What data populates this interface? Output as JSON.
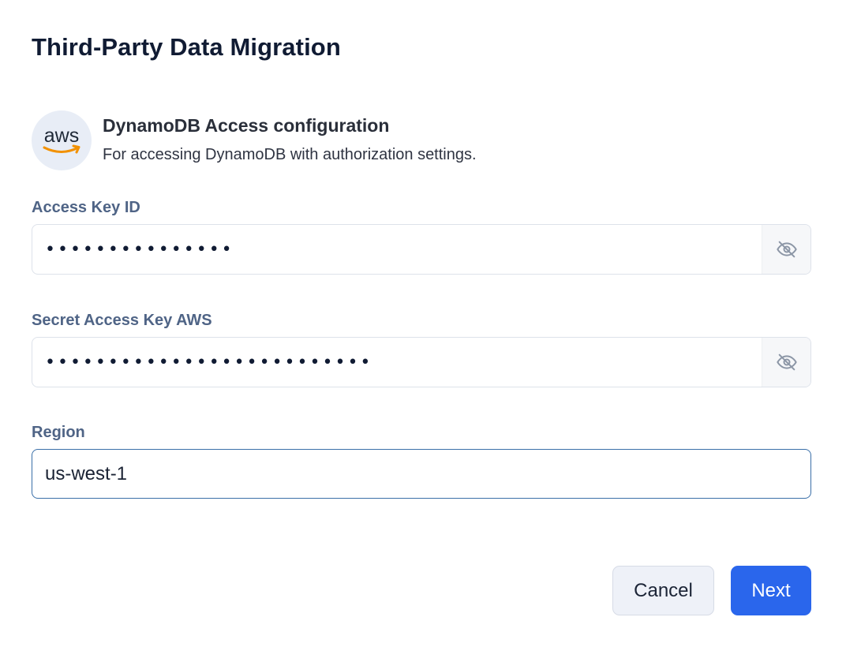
{
  "dialog": {
    "title": "Third-Party Data Migration"
  },
  "provider": {
    "logo_text": "aws",
    "title": "DynamoDB Access configuration",
    "description": "For accessing DynamoDB with authorization settings."
  },
  "fields": {
    "access_key": {
      "label": "Access Key ID",
      "masked_value": "•••••••••••••••",
      "toggle_icon": "eye-off-icon"
    },
    "secret_key": {
      "label": "Secret Access Key AWS",
      "masked_value": "••••••••••••••••••••••••••",
      "toggle_icon": "eye-off-icon"
    },
    "region": {
      "label": "Region",
      "value": "us-west-1"
    }
  },
  "buttons": {
    "cancel": "Cancel",
    "next": "Next"
  },
  "colors": {
    "title": "#101b33",
    "label": "#4f6486",
    "primary": "#2a66ec",
    "focus_border": "#3a6fa8"
  }
}
